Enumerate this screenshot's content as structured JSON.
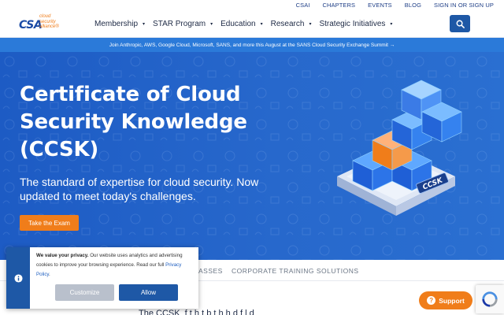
{
  "utility_links": [
    "CSAI",
    "CHAPTERS",
    "EVENTS",
    "BLOG",
    "SIGN IN OR SIGN UP"
  ],
  "logo": {
    "mark": "CSA",
    "tagline_lines": [
      "cloud",
      "security",
      "alliance®"
    ]
  },
  "nav": {
    "items": [
      {
        "label": "Membership",
        "caret": "▾"
      },
      {
        "label": "STAR Program",
        "caret": "▾"
      },
      {
        "label": "Education",
        "caret": "▾"
      },
      {
        "label": "Research",
        "caret": "▾"
      },
      {
        "label": "Strategic Initiatives",
        "caret": "▾"
      }
    ],
    "search_icon": "search-icon"
  },
  "announcement": "Join Anthropic, AWS, Google Cloud, Microsoft, SANS, and more this August at the SANS Cloud Security Exchange Summit →",
  "hero": {
    "title_lines": [
      "Certificate of Cloud",
      "Security Knowledge",
      "(CCSK)"
    ],
    "subtitle_lines": [
      "The standard of expertise for cloud security. Now",
      "updated to meet today's challenges."
    ],
    "cta_label": "Take the Exam",
    "badge_text": "CCSK"
  },
  "tabs": [
    "ASSES",
    "CORPORATE TRAINING SOLUTIONS"
  ],
  "partial_text": "The CCSK   ‌  f      t  h  t b     t  h  h     d      f  l  d",
  "privacy": {
    "heading": "We value your privacy.",
    "text": "Our website uses analytics and advertising cookies to improve your browsing experience. Read our full",
    "policy_link": "Privacy Policy",
    "period": ".",
    "customize_label": "Customize",
    "allow_label": "Allow",
    "icon": "cookie-icon"
  },
  "support": {
    "label": "Support",
    "icon": "question-icon"
  },
  "recaptcha": {
    "icon": "recaptcha-icon"
  },
  "colors": {
    "brand_blue": "#1e58a6",
    "hero_blue": "#2768cc",
    "announce_blue": "#2b7ad9",
    "accent_orange": "#f07d1a"
  }
}
